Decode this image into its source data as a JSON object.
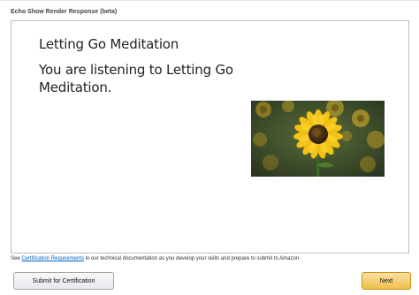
{
  "section": {
    "title": "Echo Show Render Response (beta)"
  },
  "card": {
    "title": "Letting Go Meditation",
    "body": "You are listening to Letting Go Meditation.",
    "image_icon": "sunflower-image"
  },
  "footnote": {
    "prefix": "See ",
    "link_text": "Certification Requirements",
    "suffix": " in our technical documentation as you develop your skills and prepare to submit to Amazon."
  },
  "buttons": {
    "submit_label": "Submit for Certification",
    "next_label": "Next"
  },
  "colors": {
    "link": "#0066c0",
    "primary_button": "#f0c14b",
    "frame_border": "#bdbdbd"
  }
}
